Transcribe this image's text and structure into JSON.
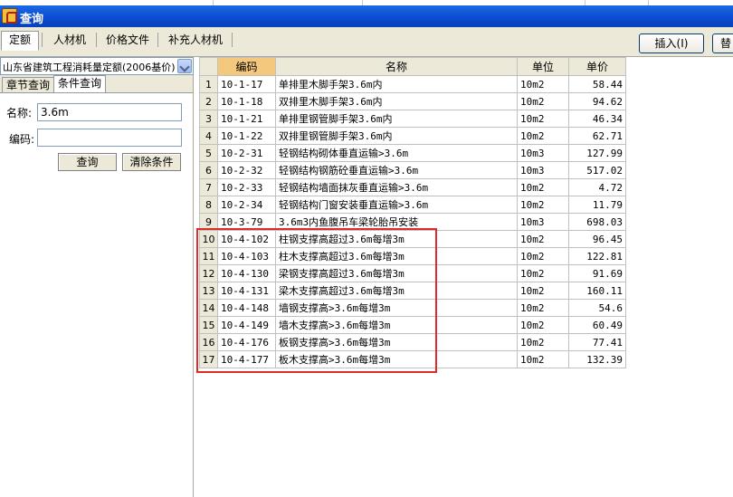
{
  "window": {
    "title": "查询"
  },
  "tabs": [
    {
      "label": "定额",
      "active": true
    },
    {
      "label": "人材机",
      "active": false
    },
    {
      "label": "价格文件",
      "active": false
    },
    {
      "label": "补充人材机",
      "active": false
    }
  ],
  "toolbar": {
    "insert_label": "插入(I)",
    "replace_label": "替"
  },
  "left": {
    "quota_select": "山东省建筑工程消耗量定额(2006基价)",
    "subtabs": [
      {
        "label": "章节查询",
        "active": false
      },
      {
        "label": "条件查询",
        "active": true
      }
    ],
    "name_label": "名称:",
    "name_value": "3.6m",
    "code_label": "编码:",
    "code_value": "",
    "query_button": "查询",
    "clear_button": "清除条件"
  },
  "grid": {
    "headers": {
      "code": "编码",
      "name": "名称",
      "unit": "单位",
      "price": "单价"
    },
    "rows": [
      {
        "n": "1",
        "code": "10-1-17",
        "name": "单排里木脚手架3.6m内",
        "unit": "10m2",
        "price": "58.44"
      },
      {
        "n": "2",
        "code": "10-1-18",
        "name": "双排里木脚手架3.6m内",
        "unit": "10m2",
        "price": "94.62"
      },
      {
        "n": "3",
        "code": "10-1-21",
        "name": "单排里钢管脚手架3.6m内",
        "unit": "10m2",
        "price": "46.34"
      },
      {
        "n": "4",
        "code": "10-1-22",
        "name": "双排里钢管脚手架3.6m内",
        "unit": "10m2",
        "price": "62.71"
      },
      {
        "n": "5",
        "code": "10-2-31",
        "name": "轻钢结构砌体垂直运输>3.6m",
        "unit": "10m3",
        "price": "127.99"
      },
      {
        "n": "6",
        "code": "10-2-32",
        "name": "轻钢结构钢筋砼垂直运输>3.6m",
        "unit": "10m3",
        "price": "517.02"
      },
      {
        "n": "7",
        "code": "10-2-33",
        "name": "轻钢结构墙面抹灰垂直运输>3.6m",
        "unit": "10m2",
        "price": "4.72"
      },
      {
        "n": "8",
        "code": "10-2-34",
        "name": "轻钢结构门窗安装垂直运输>3.6m",
        "unit": "10m2",
        "price": "11.79"
      },
      {
        "n": "9",
        "code": "10-3-79",
        "name": "3.6m3内鱼腹吊车梁轮胎吊安装",
        "unit": "10m3",
        "price": "698.03"
      },
      {
        "n": "10",
        "code": "10-4-102",
        "name": "柱钢支撑高超过3.6m每增3m",
        "unit": "10m2",
        "price": "96.45"
      },
      {
        "n": "11",
        "code": "10-4-103",
        "name": "柱木支撑高超过3.6m每增3m",
        "unit": "10m2",
        "price": "122.81"
      },
      {
        "n": "12",
        "code": "10-4-130",
        "name": "梁钢支撑高超过3.6m每增3m",
        "unit": "10m2",
        "price": "91.69"
      },
      {
        "n": "13",
        "code": "10-4-131",
        "name": "梁木支撑高超过3.6m每增3m",
        "unit": "10m2",
        "price": "160.11"
      },
      {
        "n": "14",
        "code": "10-4-148",
        "name": "墙钢支撑高>3.6m每增3m",
        "unit": "10m2",
        "price": "54.6"
      },
      {
        "n": "15",
        "code": "10-4-149",
        "name": "墙木支撑高>3.6m每增3m",
        "unit": "10m2",
        "price": "60.49"
      },
      {
        "n": "16",
        "code": "10-4-176",
        "name": "板钢支撑高>3.6m每增3m",
        "unit": "10m2",
        "price": "77.41"
      },
      {
        "n": "17",
        "code": "10-4-177",
        "name": "板木支撑高>3.6m每增3m",
        "unit": "10m2",
        "price": "132.39"
      }
    ]
  },
  "colors": {
    "highlight_box": "#e02a2a",
    "title_bar": "#0a4bd0",
    "sorted_header": "#f4c97e"
  }
}
